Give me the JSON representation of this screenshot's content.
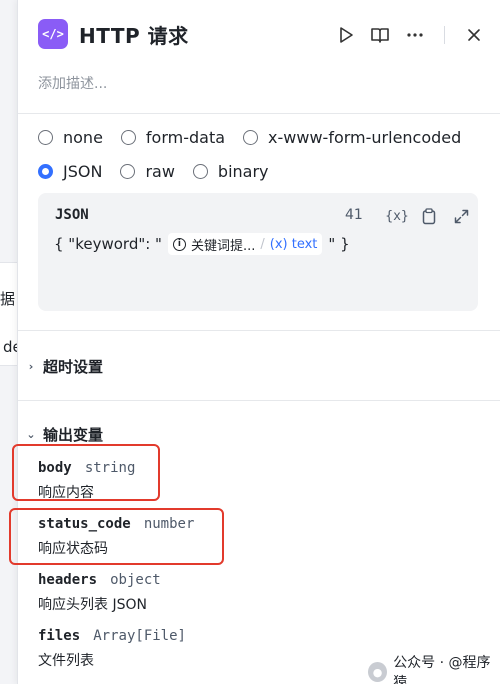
{
  "background": {
    "fragment_1": "据",
    "fragment_2": "de"
  },
  "header": {
    "app_icon_glyph": "</>",
    "title": "HTTP 请求",
    "description_placeholder": "添加描述...",
    "icons": [
      "play-icon",
      "book-icon",
      "more-icon",
      "close-icon"
    ]
  },
  "body_type": {
    "options": [
      "none",
      "form-data",
      "x-www-form-urlencoded",
      "JSON",
      "raw",
      "binary"
    ],
    "selected": "JSON"
  },
  "json_editor": {
    "label": "JSON",
    "char_count": "41",
    "var_icon": "{x}",
    "prefix": "{ \"keyword\": \"",
    "chip_name": "关键词提...",
    "chip_slash": "/",
    "chip_type": "(x) text",
    "suffix": "\" }"
  },
  "timeout_section": {
    "label": "超时设置"
  },
  "output_section": {
    "label": "输出变量",
    "variables": [
      {
        "name": "body",
        "type": "string",
        "desc": "响应内容"
      },
      {
        "name": "status_code",
        "type": "number",
        "desc": "响应状态码"
      },
      {
        "name": "headers",
        "type": "object",
        "desc": "响应头列表 JSON"
      },
      {
        "name": "files",
        "type": "Array[File]",
        "desc": "文件列表"
      }
    ]
  },
  "watermark": {
    "text": "公众号 · @程序猿"
  },
  "colors": {
    "accent": "#3370ff",
    "app_icon": "#8a5cf6",
    "highlight": "#e23a2c"
  }
}
